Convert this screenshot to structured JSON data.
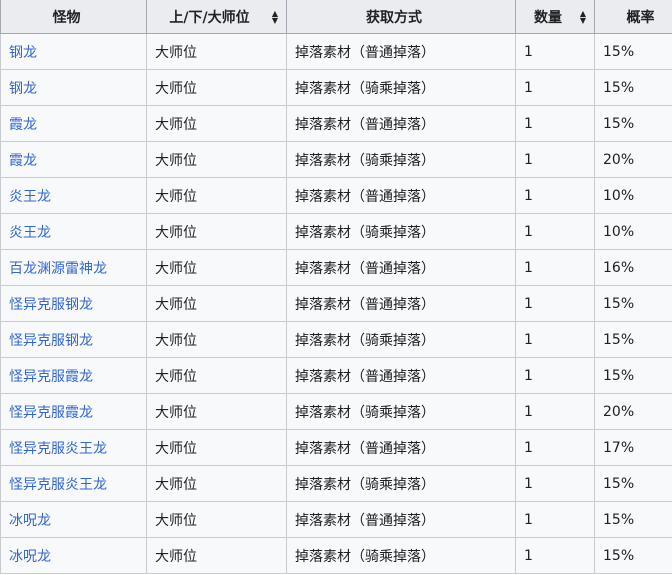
{
  "table": {
    "headers": [
      "怪物",
      "上/下/大师位",
      "获取方式",
      "数量",
      "概率"
    ],
    "rows": [
      {
        "monster": "钢龙",
        "rank": "大师位",
        "method": "掉落素材（普通掉落）",
        "qty": "1",
        "rate": "15%"
      },
      {
        "monster": "钢龙",
        "rank": "大师位",
        "method": "掉落素材（骑乘掉落）",
        "qty": "1",
        "rate": "15%"
      },
      {
        "monster": "霞龙",
        "rank": "大师位",
        "method": "掉落素材（普通掉落）",
        "qty": "1",
        "rate": "15%"
      },
      {
        "monster": "霞龙",
        "rank": "大师位",
        "method": "掉落素材（骑乘掉落）",
        "qty": "1",
        "rate": "20%"
      },
      {
        "monster": "炎王龙",
        "rank": "大师位",
        "method": "掉落素材（普通掉落）",
        "qty": "1",
        "rate": "10%"
      },
      {
        "monster": "炎王龙",
        "rank": "大师位",
        "method": "掉落素材（骑乘掉落）",
        "qty": "1",
        "rate": "10%"
      },
      {
        "monster": "百龙渊源雷神龙",
        "rank": "大师位",
        "method": "掉落素材（普通掉落）",
        "qty": "1",
        "rate": "16%"
      },
      {
        "monster": "怪异克服钢龙",
        "rank": "大师位",
        "method": "掉落素材（普通掉落）",
        "qty": "1",
        "rate": "15%"
      },
      {
        "monster": "怪异克服钢龙",
        "rank": "大师位",
        "method": "掉落素材（骑乘掉落）",
        "qty": "1",
        "rate": "15%"
      },
      {
        "monster": "怪异克服霞龙",
        "rank": "大师位",
        "method": "掉落素材（普通掉落）",
        "qty": "1",
        "rate": "15%"
      },
      {
        "monster": "怪异克服霞龙",
        "rank": "大师位",
        "method": "掉落素材（骑乘掉落）",
        "qty": "1",
        "rate": "20%"
      },
      {
        "monster": "怪异克服炎王龙",
        "rank": "大师位",
        "method": "掉落素材（普通掉落）",
        "qty": "1",
        "rate": "17%"
      },
      {
        "monster": "怪异克服炎王龙",
        "rank": "大师位",
        "method": "掉落素材（骑乘掉落）",
        "qty": "1",
        "rate": "15%"
      },
      {
        "monster": "冰呪龙",
        "rank": "大师位",
        "method": "掉落素材（普通掉落）",
        "qty": "1",
        "rate": "15%"
      },
      {
        "monster": "冰呪龙",
        "rank": "大师位",
        "method": "掉落素材（骑乘掉落）",
        "qty": "1",
        "rate": "15%"
      }
    ]
  },
  "colors": {
    "link": "#3366cc",
    "header_bg": "#eaecf0",
    "row_bg": "#f8f9fa",
    "border": "#a2a9b1"
  },
  "icons": {
    "sort": "sort-arrows-icon"
  }
}
